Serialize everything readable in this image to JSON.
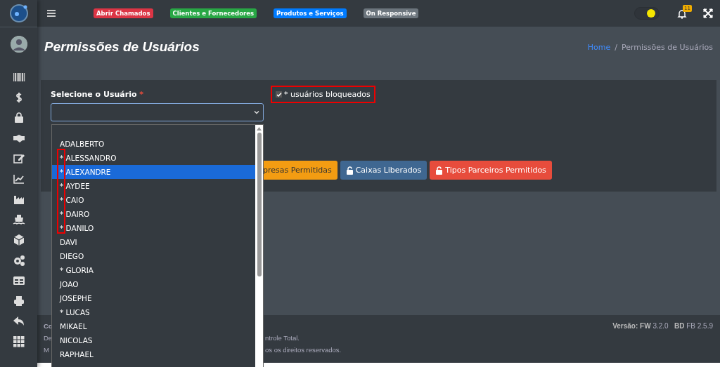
{
  "top_nav": {
    "badges": [
      {
        "label": "Abrir Chamados",
        "color": "#dc3545"
      },
      {
        "label": "Clientes e Fornecedores",
        "color": "#28a745"
      },
      {
        "label": "Produtos e Serviços",
        "color": "#007bff"
      },
      {
        "label": "On Responsive",
        "color": "#6c757d"
      }
    ],
    "notification_count": "11"
  },
  "page_title": "Permissões de Usuários",
  "breadcrumb": [
    {
      "label": "Home",
      "kind": "link"
    },
    {
      "label": "/",
      "kind": "separator"
    },
    {
      "label": "Permissões de Usuários",
      "kind": "current"
    }
  ],
  "form": {
    "user_label": "Selecione o Usuário",
    "required_mark": "*",
    "blocked_checkbox": {
      "label": "* usuários bloqueados",
      "checked": true
    },
    "buttons": [
      {
        "label": "presas Permitidas",
        "color": "#f39c12"
      },
      {
        "label": "Caixas Liberados",
        "color": "#3f6791"
      },
      {
        "label": "Tipos Parceiros Permitidos",
        "color": "#e74c3c"
      }
    ],
    "dropdown": {
      "options": [
        {
          "label": "ADALBERTO",
          "selected": false
        },
        {
          "label": "* ALESSANDRO",
          "selected": false
        },
        {
          "label": "* ALEXANDRE",
          "selected": true
        },
        {
          "label": "* AYDEE",
          "selected": false
        },
        {
          "label": "* CAIO",
          "selected": false
        },
        {
          "label": "* DAIRO",
          "selected": false
        },
        {
          "label": "* DANILO",
          "selected": false
        },
        {
          "label": "DAVI",
          "selected": false
        },
        {
          "label": "DIEGO",
          "selected": false
        },
        {
          "label": "* GLORIA",
          "selected": false
        },
        {
          "label": "JOAO",
          "selected": false
        },
        {
          "label": "JOSEPHE",
          "selected": false
        },
        {
          "label": "* LUCAS",
          "selected": false
        },
        {
          "label": "MIKAEL",
          "selected": false
        },
        {
          "label": "NICOLAS",
          "selected": false
        },
        {
          "label": "RAPHAEL",
          "selected": false
        }
      ]
    }
  },
  "footer": {
    "lines": [
      {
        "left": "Co"
      },
      {
        "left": "De",
        "right": "ntrole Total."
      },
      {
        "left": "M",
        "right": "os os direitos reservados."
      }
    ],
    "version": "**Versão: FW** 3.2.0   **BD** FB 2.5.9"
  },
  "theme_toggle": {
    "on": true
  }
}
